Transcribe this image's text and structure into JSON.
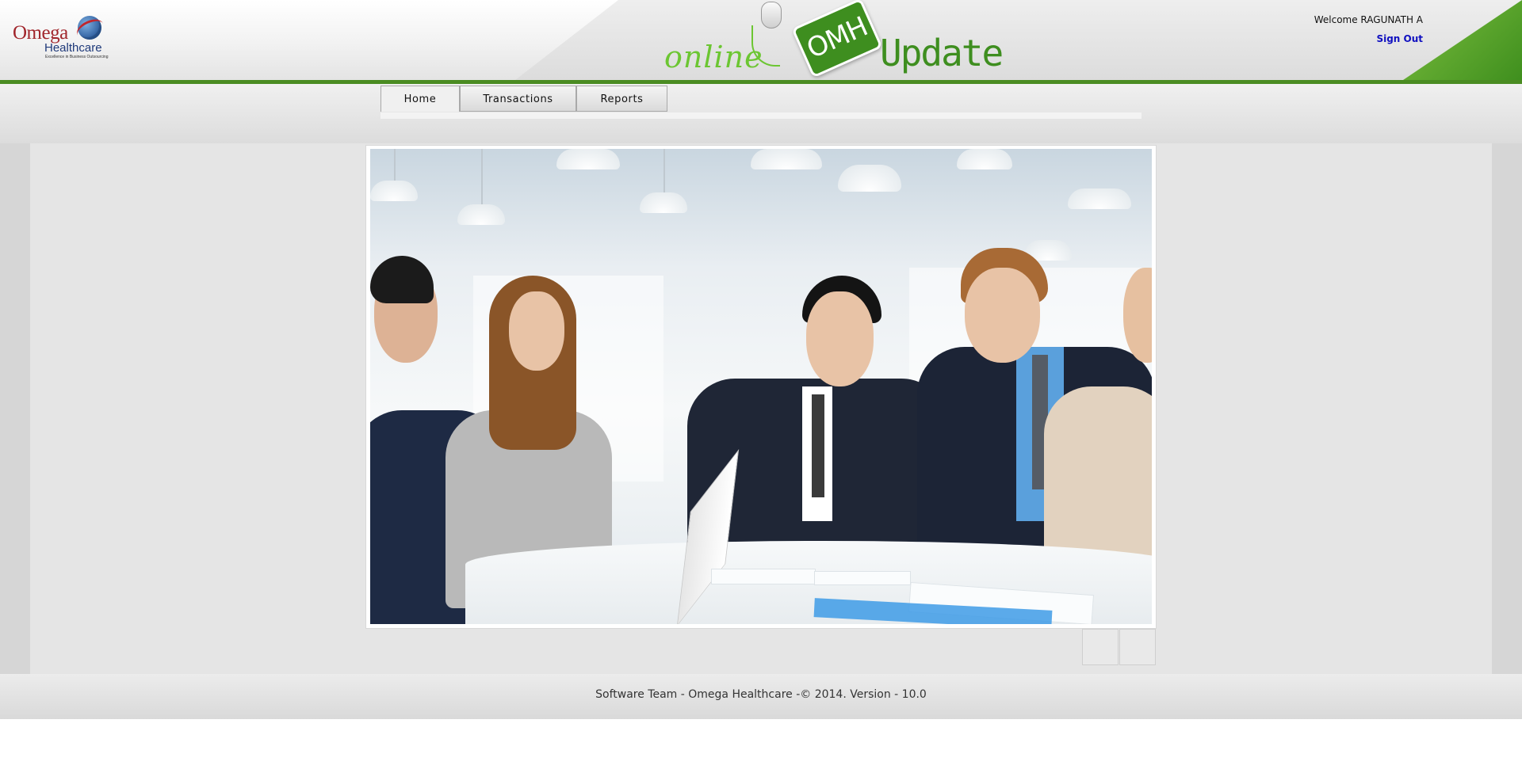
{
  "header": {
    "logo": {
      "name_line1": "Omega",
      "name_line2": "Healthcare",
      "tagline": "Excellence in Business Outsourcing"
    },
    "banner": {
      "word1": "online",
      "badge": "OMH",
      "word2": "Update"
    },
    "welcome_text": "Welcome RAGUNATH A",
    "signout_label": "Sign Out"
  },
  "nav": {
    "tabs": [
      {
        "label": "Home",
        "active": true
      },
      {
        "label": "Transactions",
        "active": false
      },
      {
        "label": "Reports",
        "active": false
      }
    ]
  },
  "footer": {
    "text": "Software Team - Omega Healthcare -© 2014. Version - 10.0"
  },
  "colors": {
    "brand_green": "#3e8e1f",
    "accent_green": "#6cc632",
    "signout_blue": "#1010c0",
    "logo_red": "#a1262c",
    "logo_blue": "#1f3a7a"
  }
}
